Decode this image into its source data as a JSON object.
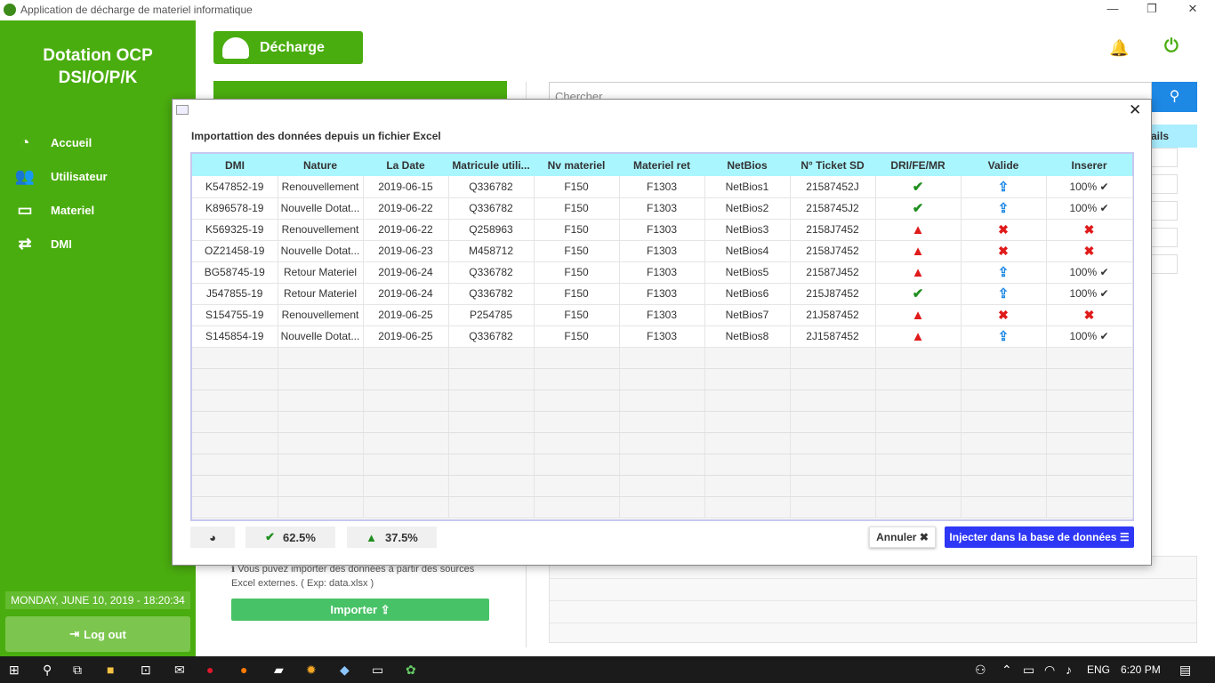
{
  "window": {
    "title": "Application de décharge de materiel informatique",
    "minimize": "—",
    "restore": "❐",
    "close": "✕"
  },
  "sidebar": {
    "brand_line1": "Dotation OCP",
    "brand_line2": "DSI/O/P/K",
    "items": [
      {
        "label": "Accueil",
        "icon": "dashboard-icon"
      },
      {
        "label": "Utilisateur",
        "icon": "users-icon"
      },
      {
        "label": "Materiel",
        "icon": "monitor-icon"
      },
      {
        "label": "DMI",
        "icon": "exchange-icon"
      }
    ],
    "datetime": "MONDAY, JUNE 10, 2019 - 18:20:34",
    "logout_label": "Log out"
  },
  "header": {
    "page_label": "Décharge"
  },
  "search": {
    "placeholder": "Chercher"
  },
  "background": {
    "col_fragment": "ails",
    "info_text": "Vous puvez importer des données à partir des sources Excel externes. ( Exp: data.xlsx )",
    "importer_label": "Importer"
  },
  "dialog": {
    "heading": "Importattion des données depuis un fichier Excel",
    "columns": [
      "DMI",
      "Nature",
      "La Date",
      "Matricule utili...",
      "Nv materiel",
      "Materiel ret",
      "NetBios",
      "N° Ticket SD",
      "DRI/FE/MR",
      "Valide",
      "Inserer"
    ],
    "rows": [
      {
        "dmi": "K547852-19",
        "nature": "Renouvellement",
        "date": "2019-06-15",
        "matricule": "Q336782",
        "nv": "F150",
        "ret": "F1303",
        "netbios": "NetBios1",
        "ticket": "21587452J",
        "dri": "ok",
        "valide": "upload",
        "inserer": "100%"
      },
      {
        "dmi": "K896578-19",
        "nature": "Nouvelle Dotat...",
        "date": "2019-06-22",
        "matricule": "Q336782",
        "nv": "F150",
        "ret": "F1303",
        "netbios": "NetBios2",
        "ticket": "2158745J2",
        "dri": "ok",
        "valide": "upload",
        "inserer": "100%"
      },
      {
        "dmi": "K569325-19",
        "nature": "Renouvellement",
        "date": "2019-06-22",
        "matricule": "Q258963",
        "nv": "F150",
        "ret": "F1303",
        "netbios": "NetBios3",
        "ticket": "2158J7452",
        "dri": "warn",
        "valide": "error",
        "inserer": ""
      },
      {
        "dmi": "OZ21458-19",
        "nature": "Nouvelle Dotat...",
        "date": "2019-06-23",
        "matricule": "M458712",
        "nv": "F150",
        "ret": "F1303",
        "netbios": "NetBios4",
        "ticket": "2158J7452",
        "dri": "warn",
        "valide": "error",
        "inserer": ""
      },
      {
        "dmi": "BG58745-19",
        "nature": "Retour Materiel",
        "date": "2019-06-24",
        "matricule": "Q336782",
        "nv": "F150",
        "ret": "F1303",
        "netbios": "NetBios5",
        "ticket": "21587J452",
        "dri": "warn",
        "valide": "upload",
        "inserer": "100%"
      },
      {
        "dmi": "J547855-19",
        "nature": "Retour Materiel",
        "date": "2019-06-24",
        "matricule": "Q336782",
        "nv": "F150",
        "ret": "F1303",
        "netbios": "NetBios6",
        "ticket": "215J87452",
        "dri": "ok",
        "valide": "upload",
        "inserer": "100%"
      },
      {
        "dmi": "S154755-19",
        "nature": "Renouvellement",
        "date": "2019-06-25",
        "matricule": "P254785",
        "nv": "F150",
        "ret": "F1303",
        "netbios": "NetBios7",
        "ticket": "21J587452",
        "dri": "warn",
        "valide": "error",
        "inserer": ""
      },
      {
        "dmi": "S145854-19",
        "nature": "Nouvelle Dotat...",
        "date": "2019-06-25",
        "matricule": "Q336782",
        "nv": "F150",
        "ret": "F1303",
        "netbios": "NetBios8",
        "ticket": "2J1587452",
        "dri": "warn",
        "valide": "upload",
        "inserer": "100%"
      }
    ],
    "empty_rows": 8,
    "stats": {
      "ok_percent": "62.5%",
      "warn_percent": "37.5%"
    },
    "cancel_label": "Annuler",
    "inject_label": "Injecter dans la base de données"
  },
  "taskbar": {
    "language": "ENG",
    "time": "6:20 PM"
  },
  "colors": {
    "brand_green": "#4aad0f",
    "accent_blue": "#1e88e5",
    "inject_blue": "#2e37f5",
    "header_cyan": "#aaf6ff",
    "error_red": "#e01b1b"
  }
}
